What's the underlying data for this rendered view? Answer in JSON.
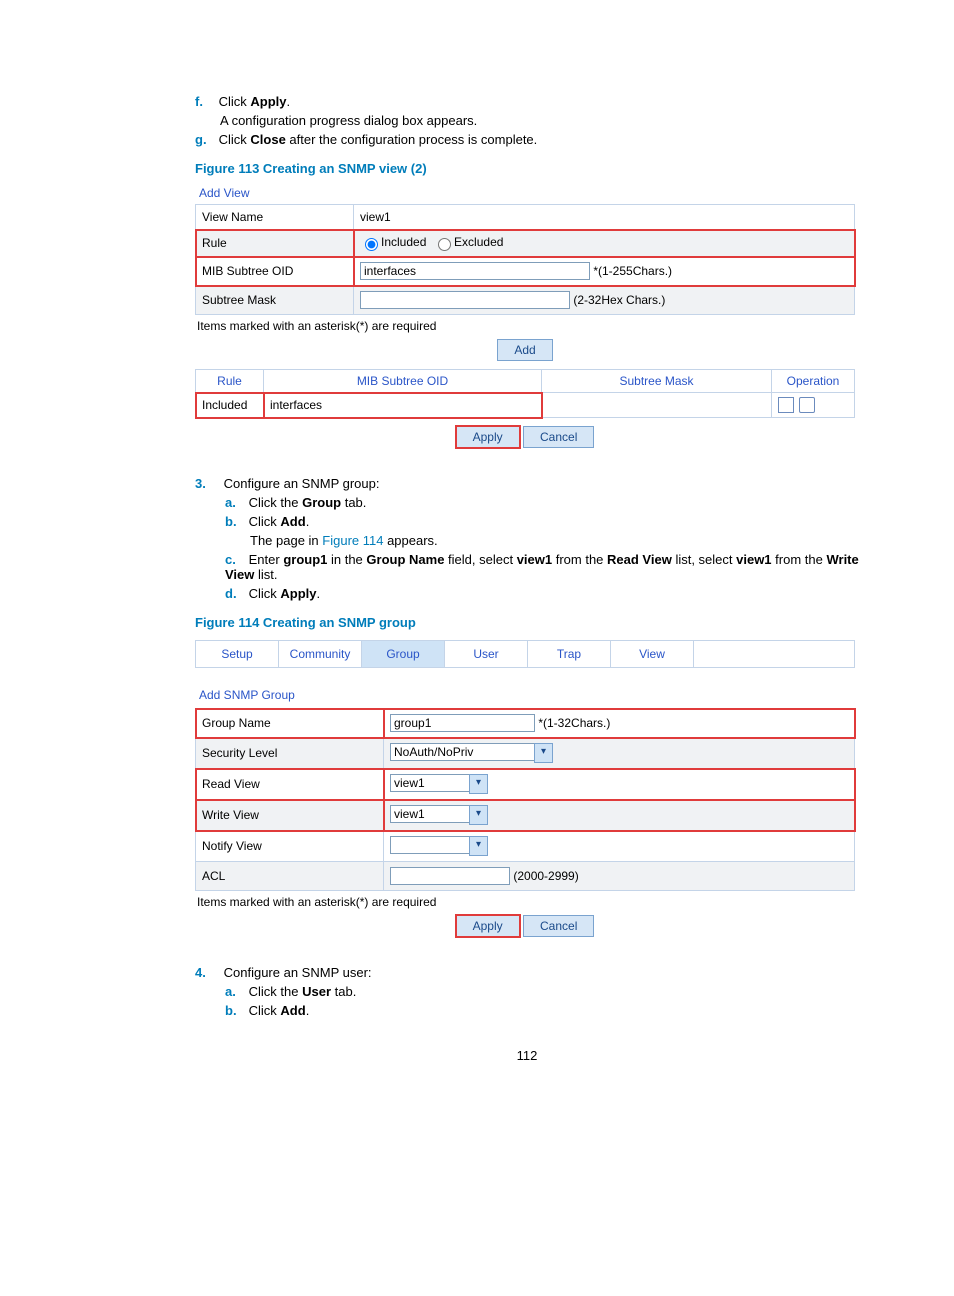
{
  "page_number": "112",
  "steps_top": {
    "f": {
      "label": "f.",
      "text_a": "Click ",
      "bold": "Apply",
      "text_b": ".",
      "sub": "A configuration progress dialog box appears."
    },
    "g": {
      "label": "g.",
      "text_a": "Click ",
      "bold": "Close",
      "text_b": " after the configuration process is complete."
    }
  },
  "figure113": {
    "title": "Figure 113 Creating an SNMP view (2)",
    "section_title": "Add View",
    "rows": {
      "viewname": {
        "label": "View Name",
        "value": "view1"
      },
      "rule": {
        "label": "Rule",
        "opt1": "Included",
        "opt2": "Excluded"
      },
      "mib": {
        "label": "MIB Subtree OID",
        "value": "interfaces",
        "hint": "*(1-255Chars.)"
      },
      "mask": {
        "label": "Subtree Mask",
        "value": "",
        "hint": "(2-32Hex Chars.)"
      }
    },
    "req_note": "Items marked with an asterisk(*) are required",
    "add_btn": "Add",
    "table": {
      "h1": "Rule",
      "h2": "MIB Subtree OID",
      "h3": "Subtree Mask",
      "h4": "Operation",
      "c1": "Included",
      "c2": "interfaces",
      "c3": ""
    },
    "apply_btn": "Apply",
    "cancel_btn": "Cancel"
  },
  "step3": {
    "num": "3.",
    "intro": "Configure an SNMP group:",
    "a": {
      "label": "a.",
      "pre": "Click the ",
      "bold": "Group",
      "post": " tab."
    },
    "b": {
      "label": "b.",
      "pre": "Click ",
      "bold": "Add",
      "post": ".",
      "sub_a": "The page in ",
      "sub_link": "Figure 114",
      "sub_b": " appears."
    },
    "c": {
      "label": "c.",
      "t1": "Enter ",
      "b1": "group1",
      "t2": " in the ",
      "b2": "Group Name",
      "t3": " field, select ",
      "b3": "view1",
      "t4": " from the ",
      "b4": "Read View",
      "t5": " list, select ",
      "b5": "view1",
      "t6": " from the ",
      "b6": "Write View",
      "t7": " list."
    },
    "d": {
      "label": "d.",
      "pre": "Click ",
      "bold": "Apply",
      "post": "."
    }
  },
  "figure114": {
    "title": "Figure 114 Creating an SNMP group",
    "tabs": [
      "Setup",
      "Community",
      "Group",
      "User",
      "Trap",
      "View"
    ],
    "section_title": "Add SNMP Group",
    "rows": {
      "groupname": {
        "label": "Group Name",
        "value": "group1",
        "hint": "*(1-32Chars.)"
      },
      "seclevel": {
        "label": "Security Level",
        "value": "NoAuth/NoPriv"
      },
      "readview": {
        "label": "Read View",
        "value": "view1"
      },
      "writeview": {
        "label": "Write View",
        "value": "view1"
      },
      "notifyview": {
        "label": "Notify View",
        "value": ""
      },
      "acl": {
        "label": "ACL",
        "value": "",
        "hint": "(2000-2999)"
      }
    },
    "req_note": "Items marked with an asterisk(*) are required",
    "apply_btn": "Apply",
    "cancel_btn": "Cancel"
  },
  "step4": {
    "num": "4.",
    "intro": "Configure an SNMP user:",
    "a": {
      "label": "a.",
      "pre": "Click the ",
      "bold": "User",
      "post": " tab."
    },
    "b": {
      "label": "b.",
      "pre": "Click ",
      "bold": "Add",
      "post": "."
    }
  }
}
